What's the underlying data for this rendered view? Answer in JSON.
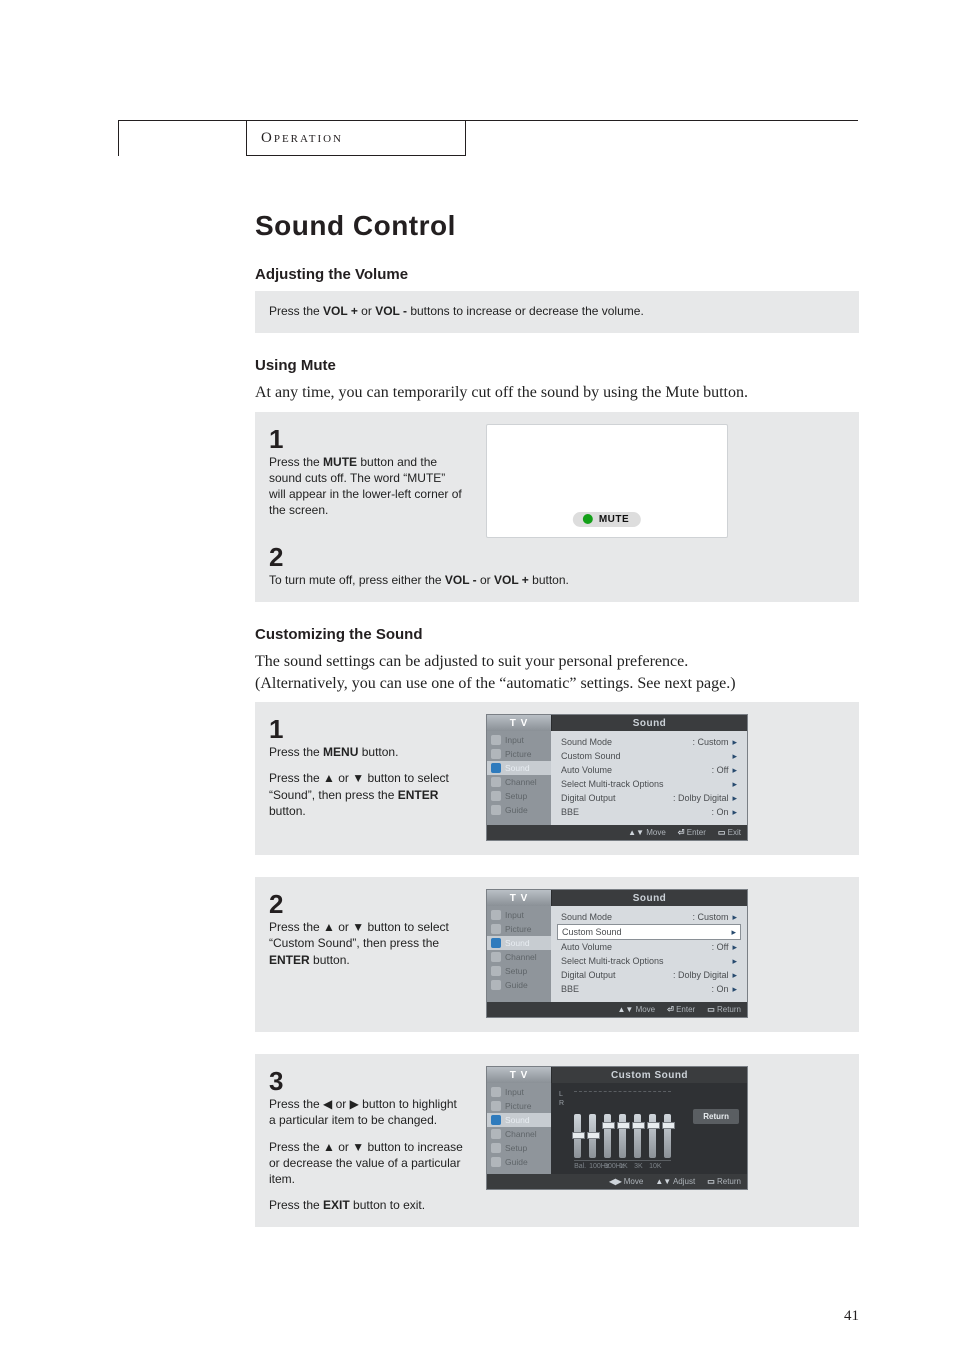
{
  "header": {
    "section": "Operation"
  },
  "title": "Sound Control",
  "page_number": "41",
  "sections": {
    "adjust_volume": {
      "heading": "Adjusting the Volume",
      "text_parts": [
        "Press the ",
        "VOL +",
        " or ",
        "VOL -",
        " buttons to increase or decrease the volume."
      ]
    },
    "mute": {
      "heading": "Using Mute",
      "intro": "At any time, you can temporarily cut off the sound by using the Mute button.",
      "badge": "MUTE",
      "steps": [
        {
          "num": "1",
          "parts": [
            "Press the ",
            "MUTE",
            " button and the sound cuts off. The word “MUTE” will appear in the lower-left corner of the screen."
          ]
        },
        {
          "num": "2",
          "parts": [
            "To turn mute off, press either the ",
            "VOL -",
            " or ",
            "VOL +",
            " button."
          ]
        }
      ]
    },
    "custom": {
      "heading": "Customizing the Sound",
      "intro1": "The sound settings can be adjusted to suit your personal preference.",
      "intro2": "(Alternatively, you can use one of the “automatic” settings. See next page.)",
      "steps": [
        {
          "num": "1",
          "l1": [
            "Press the ",
            "MENU",
            " button."
          ],
          "l2": [
            "Press the ▲ or ▼ button to select “Sound”, then press the ",
            "ENTER",
            " button."
          ]
        },
        {
          "num": "2",
          "parts": [
            "Press the ▲ or ▼ button to select “Custom Sound”, then press the ",
            "ENTER",
            " button."
          ]
        },
        {
          "num": "3",
          "l1": "Press the ◀ or ▶ button to highlight a particular item to be changed.",
          "l2": "Press the ▲ or ▼ button to increase or decrease the value of a particular item.",
          "l3": [
            "Press the ",
            "EXIT",
            " button to exit."
          ]
        }
      ]
    }
  },
  "osd": {
    "tv": "T V",
    "sound_title": "Sound",
    "custom_title": "Custom Sound",
    "return_btn": "Return",
    "nav": [
      "Input",
      "Picture",
      "Sound",
      "Channel",
      "Setup",
      "Guide"
    ],
    "items": [
      {
        "k": "Sound Mode",
        "v": ": Custom"
      },
      {
        "k": "Custom Sound",
        "v": ""
      },
      {
        "k": "Auto Volume",
        "v": ": Off"
      },
      {
        "k": "Select Multi-track Options",
        "v": ""
      },
      {
        "k": "Digital Output",
        "v": ": Dolby Digital"
      },
      {
        "k": "BBE",
        "v": ": On"
      }
    ],
    "help": {
      "move": "Move",
      "enter": "Enter",
      "exit": "Exit",
      "return": "Return",
      "adjust": "Adjust"
    },
    "eq": {
      "scale": [
        "L",
        "R"
      ],
      "labels": [
        "Bal.",
        "100Hz",
        "300Hz",
        "1K",
        "3K",
        "10K",
        ""
      ]
    }
  }
}
